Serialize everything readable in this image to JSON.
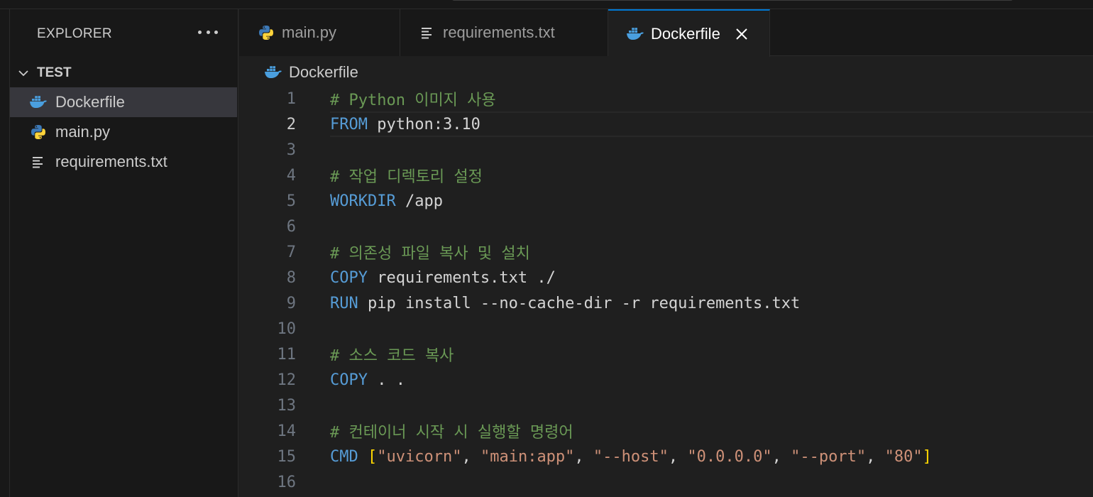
{
  "sidebar": {
    "title": "EXPLORER",
    "folder": "TEST",
    "files": [
      {
        "name": "Dockerfile",
        "icon": "docker-icon",
        "selected": true
      },
      {
        "name": "main.py",
        "icon": "python-icon",
        "selected": false
      },
      {
        "name": "requirements.txt",
        "icon": "text-file-icon",
        "selected": false
      }
    ]
  },
  "tabs": [
    {
      "label": "main.py",
      "icon": "python-icon",
      "active": false
    },
    {
      "label": "requirements.txt",
      "icon": "text-file-icon",
      "active": false
    },
    {
      "label": "Dockerfile",
      "icon": "docker-icon",
      "active": true
    }
  ],
  "breadcrumb": {
    "label": "Dockerfile",
    "icon": "docker-icon"
  },
  "editor": {
    "current_line": 2,
    "lines": [
      {
        "n": "1",
        "tokens": [
          {
            "t": "# Python 이미지 사용",
            "c": "comment"
          }
        ]
      },
      {
        "n": "2",
        "tokens": [
          {
            "t": "FROM",
            "c": "kw"
          },
          {
            "t": " python:3.10",
            "c": "text"
          }
        ]
      },
      {
        "n": "3",
        "tokens": []
      },
      {
        "n": "4",
        "tokens": [
          {
            "t": "# 작업 디렉토리 설정",
            "c": "comment"
          }
        ]
      },
      {
        "n": "5",
        "tokens": [
          {
            "t": "WORKDIR",
            "c": "kw"
          },
          {
            "t": " /app",
            "c": "text"
          }
        ]
      },
      {
        "n": "6",
        "tokens": []
      },
      {
        "n": "7",
        "tokens": [
          {
            "t": "# 의존성 파일 복사 및 설치",
            "c": "comment"
          }
        ]
      },
      {
        "n": "8",
        "tokens": [
          {
            "t": "COPY",
            "c": "kw"
          },
          {
            "t": " requirements.txt ./",
            "c": "text"
          }
        ]
      },
      {
        "n": "9",
        "tokens": [
          {
            "t": "RUN",
            "c": "kw"
          },
          {
            "t": " pip install --no-cache-dir -r requirements.txt",
            "c": "text"
          }
        ]
      },
      {
        "n": "10",
        "tokens": []
      },
      {
        "n": "11",
        "tokens": [
          {
            "t": "# 소스 코드 복사",
            "c": "comment"
          }
        ]
      },
      {
        "n": "12",
        "tokens": [
          {
            "t": "COPY",
            "c": "kw"
          },
          {
            "t": " . .",
            "c": "text"
          }
        ]
      },
      {
        "n": "13",
        "tokens": []
      },
      {
        "n": "14",
        "tokens": [
          {
            "t": "# 컨테이너 시작 시 실행할 명령어",
            "c": "comment"
          }
        ]
      },
      {
        "n": "15",
        "tokens": [
          {
            "t": "CMD",
            "c": "kw"
          },
          {
            "t": " ",
            "c": "text"
          },
          {
            "t": "[",
            "c": "bracket"
          },
          {
            "t": "\"uvicorn\"",
            "c": "str"
          },
          {
            "t": ", ",
            "c": "text"
          },
          {
            "t": "\"main:app\"",
            "c": "str"
          },
          {
            "t": ", ",
            "c": "text"
          },
          {
            "t": "\"--host\"",
            "c": "str"
          },
          {
            "t": ", ",
            "c": "text"
          },
          {
            "t": "\"0.0.0.0\"",
            "c": "str"
          },
          {
            "t": ", ",
            "c": "text"
          },
          {
            "t": "\"--port\"",
            "c": "str"
          },
          {
            "t": ", ",
            "c": "text"
          },
          {
            "t": "\"80\"",
            "c": "str"
          },
          {
            "t": "]",
            "c": "bracket"
          }
        ]
      },
      {
        "n": "16",
        "tokens": []
      }
    ]
  },
  "colors": {
    "accent": "#0078d4",
    "docker": "#4a9fdf",
    "python_blue": "#3d7ab8",
    "python_yellow": "#ffd43b",
    "comment": "#6a9955",
    "keyword": "#569cd6",
    "string": "#ce9178",
    "bracket": "#ffd700"
  }
}
